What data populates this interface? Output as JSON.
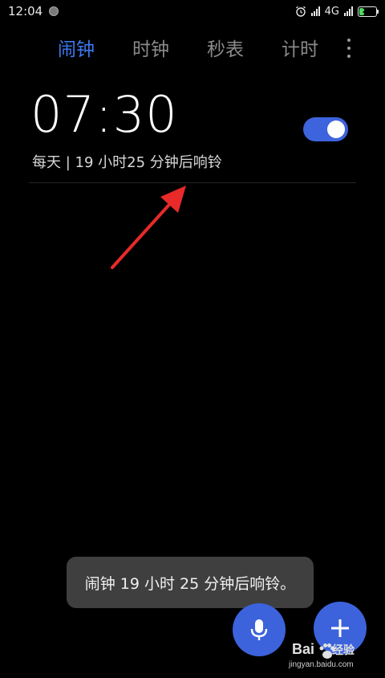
{
  "status_bar": {
    "time": "12:04",
    "network": "4G",
    "battery": "29",
    "battery_level": 0.29
  },
  "tabs": [
    {
      "label": "闹钟",
      "active": true
    },
    {
      "label": "时钟",
      "active": false
    },
    {
      "label": "秒表",
      "active": false
    },
    {
      "label": "计时",
      "active": false
    }
  ],
  "alarm": {
    "time": "07:30",
    "description": "每天 | 19 小时25 分钟后响铃",
    "enabled": true
  },
  "toast": {
    "message": "闹钟 19 小时 25 分钟后响铃。"
  },
  "icons": {
    "more": "more-vertical-icon",
    "mic": "microphone-icon",
    "add": "plus-icon",
    "alarm_status": "alarm-clock-icon"
  },
  "colors": {
    "accent": "#3d78f0",
    "fab": "#3c63dc",
    "toggle_on": "#3d63dd",
    "toast_bg": "#3f3f3f",
    "annotation": "#e82a2a"
  },
  "watermark": {
    "logo_text": "Bai",
    "logo_cn": "经验",
    "url": "jingyan.baidu.com"
  }
}
